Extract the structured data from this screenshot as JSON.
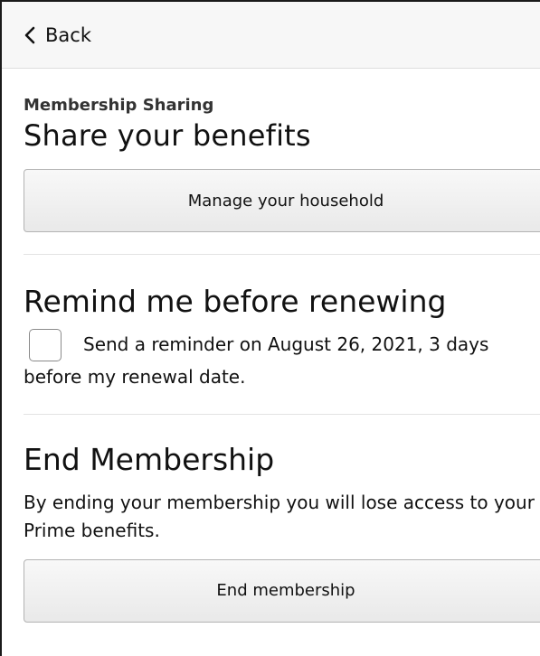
{
  "header": {
    "back_label": "Back"
  },
  "sharing": {
    "eyebrow": "Membership Sharing",
    "heading": "Share your benefits",
    "button_label": "Manage your household"
  },
  "reminder": {
    "heading": "Remind me before renewing",
    "checkbox_checked": false,
    "text_line1": "Send a reminder on August 26, 2021, 3 days",
    "text_line2": "before my renewal date."
  },
  "end": {
    "heading": "End Membership",
    "description": "By ending your membership you will lose access to your Prime benefits.",
    "button_label": "End membership"
  },
  "colors": {
    "header_bg": "#f7f7f7",
    "button_bg": "#eeeeee",
    "divider": "#e3e3e3",
    "text": "#111111"
  },
  "icons": {
    "back": "chevron-left-icon"
  }
}
